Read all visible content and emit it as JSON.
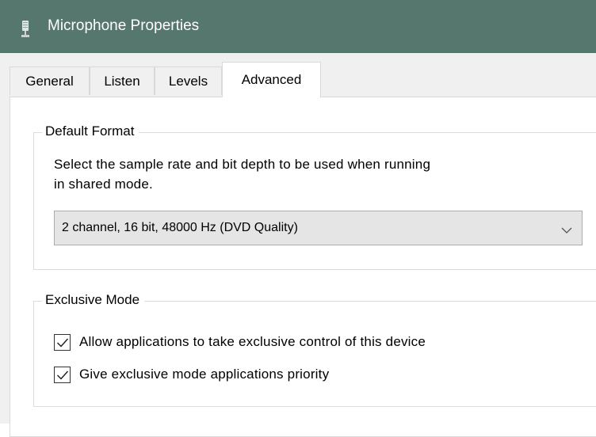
{
  "window": {
    "title": "Microphone Properties",
    "icon": "microphone-icon"
  },
  "tabs": [
    {
      "label": "General",
      "active": false
    },
    {
      "label": "Listen",
      "active": false
    },
    {
      "label": "Levels",
      "active": false
    },
    {
      "label": "Advanced",
      "active": true
    }
  ],
  "default_format": {
    "legend": "Default Format",
    "description_line1": "Select the sample rate and bit depth to be used when running",
    "description_line2": "in shared mode.",
    "selected": "2 channel, 16 bit, 48000 Hz (DVD Quality)"
  },
  "exclusive_mode": {
    "legend": "Exclusive Mode",
    "options": [
      {
        "label": "Allow applications to take exclusive control of this device",
        "checked": true
      },
      {
        "label": "Give exclusive mode applications priority",
        "checked": true
      }
    ]
  },
  "colors": {
    "titlebar": "#56776e",
    "checkmark": "#1a1a1a"
  }
}
